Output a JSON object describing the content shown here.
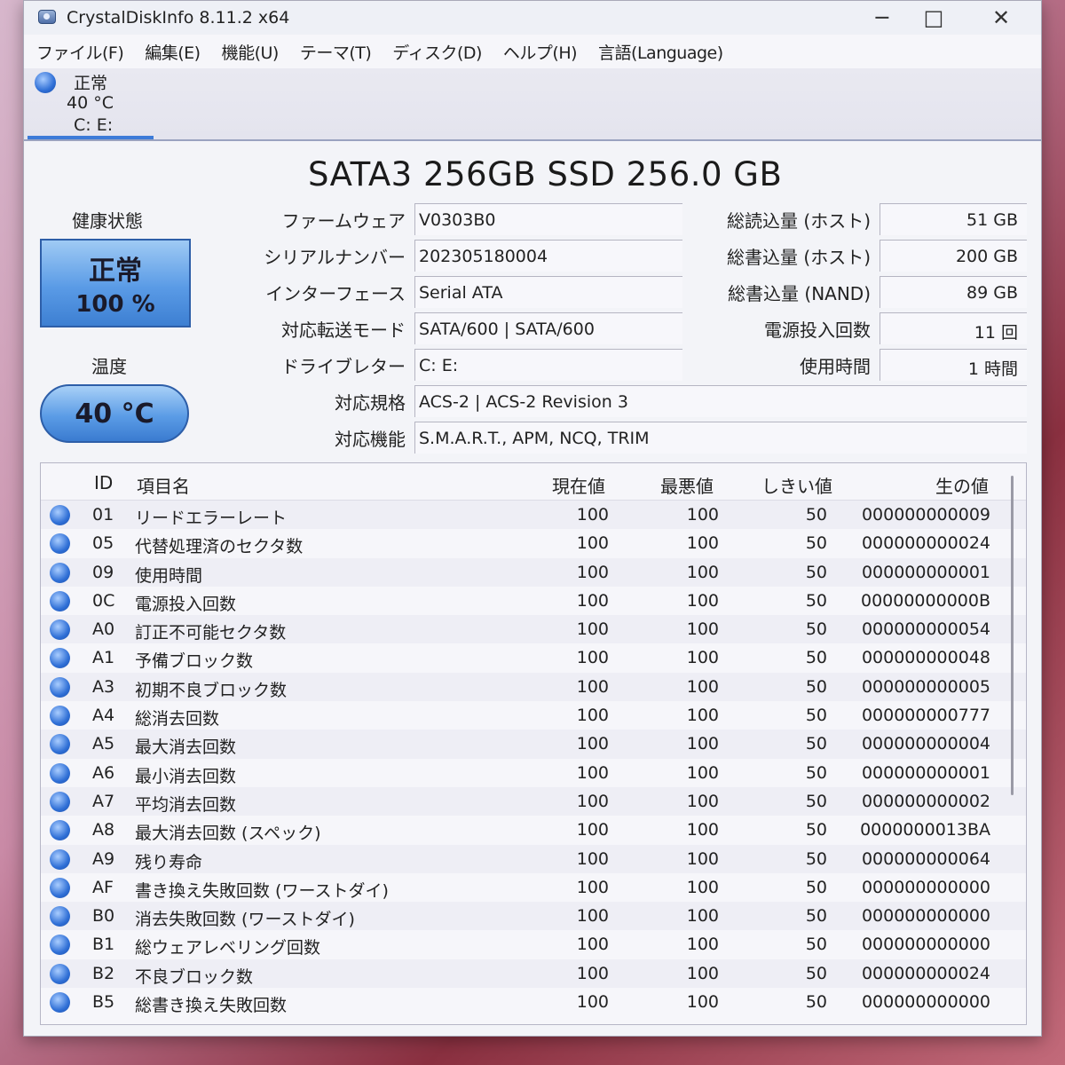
{
  "window": {
    "title": "CrystalDiskInfo 8.11.2 x64"
  },
  "menu": [
    "ファイル(F)",
    "編集(E)",
    "機能(U)",
    "テーマ(T)",
    "ディスク(D)",
    "ヘルプ(H)",
    "言語(Language)"
  ],
  "disk_tab": {
    "status": "正常",
    "temp": "40 °C",
    "drives": "C: E:"
  },
  "model": "SATA3 256GB SSD 256.0 GB",
  "health": {
    "label": "健康状態",
    "status": "正常",
    "percent": "100 %"
  },
  "temperature": {
    "label": "温度",
    "value": "40 °C"
  },
  "info": [
    {
      "label": "ファームウェア",
      "value": "V0303B0"
    },
    {
      "label": "シリアルナンバー",
      "value": "202305180004"
    },
    {
      "label": "インターフェース",
      "value": "Serial ATA"
    },
    {
      "label": "対応転送モード",
      "value": "SATA/600 | SATA/600"
    },
    {
      "label": "ドライブレター",
      "value": "C: E:"
    },
    {
      "label": "対応規格",
      "value": "ACS-2 | ACS-2 Revision 3"
    },
    {
      "label": "対応機能",
      "value": "S.M.A.R.T., APM, NCQ, TRIM"
    }
  ],
  "stats": [
    {
      "label": "総読込量 (ホスト)",
      "value": "51 GB"
    },
    {
      "label": "総書込量 (ホスト)",
      "value": "200 GB"
    },
    {
      "label": "総書込量 (NAND)",
      "value": "89 GB"
    },
    {
      "label": "電源投入回数",
      "value": "11 回"
    },
    {
      "label": "使用時間",
      "value": "1 時間"
    }
  ],
  "smart": {
    "headers": {
      "id": "ID",
      "name": "項目名",
      "current": "現在値",
      "worst": "最悪値",
      "threshold": "しきい値",
      "raw": "生の値"
    },
    "rows": [
      {
        "id": "01",
        "name": "リードエラーレート",
        "current": "100",
        "worst": "100",
        "threshold": "50",
        "raw": "000000000009"
      },
      {
        "id": "05",
        "name": "代替処理済のセクタ数",
        "current": "100",
        "worst": "100",
        "threshold": "50",
        "raw": "000000000024"
      },
      {
        "id": "09",
        "name": "使用時間",
        "current": "100",
        "worst": "100",
        "threshold": "50",
        "raw": "000000000001"
      },
      {
        "id": "0C",
        "name": "電源投入回数",
        "current": "100",
        "worst": "100",
        "threshold": "50",
        "raw": "00000000000B"
      },
      {
        "id": "A0",
        "name": "訂正不可能セクタ数",
        "current": "100",
        "worst": "100",
        "threshold": "50",
        "raw": "000000000054"
      },
      {
        "id": "A1",
        "name": "予備ブロック数",
        "current": "100",
        "worst": "100",
        "threshold": "50",
        "raw": "000000000048"
      },
      {
        "id": "A3",
        "name": "初期不良ブロック数",
        "current": "100",
        "worst": "100",
        "threshold": "50",
        "raw": "000000000005"
      },
      {
        "id": "A4",
        "name": "総消去回数",
        "current": "100",
        "worst": "100",
        "threshold": "50",
        "raw": "000000000777"
      },
      {
        "id": "A5",
        "name": "最大消去回数",
        "current": "100",
        "worst": "100",
        "threshold": "50",
        "raw": "000000000004"
      },
      {
        "id": "A6",
        "name": "最小消去回数",
        "current": "100",
        "worst": "100",
        "threshold": "50",
        "raw": "000000000001"
      },
      {
        "id": "A7",
        "name": "平均消去回数",
        "current": "100",
        "worst": "100",
        "threshold": "50",
        "raw": "000000000002"
      },
      {
        "id": "A8",
        "name": "最大消去回数 (スペック)",
        "current": "100",
        "worst": "100",
        "threshold": "50",
        "raw": "0000000013BA"
      },
      {
        "id": "A9",
        "name": "残り寿命",
        "current": "100",
        "worst": "100",
        "threshold": "50",
        "raw": "000000000064"
      },
      {
        "id": "AF",
        "name": "書き換え失敗回数 (ワーストダイ)",
        "current": "100",
        "worst": "100",
        "threshold": "50",
        "raw": "000000000000"
      },
      {
        "id": "B0",
        "name": "消去失敗回数 (ワーストダイ)",
        "current": "100",
        "worst": "100",
        "threshold": "50",
        "raw": "000000000000"
      },
      {
        "id": "B1",
        "name": "総ウェアレベリング回数",
        "current": "100",
        "worst": "100",
        "threshold": "50",
        "raw": "000000000000"
      },
      {
        "id": "B2",
        "name": "不良ブロック数",
        "current": "100",
        "worst": "100",
        "threshold": "50",
        "raw": "000000000024"
      },
      {
        "id": "B5",
        "name": "総書き換え失敗回数",
        "current": "100",
        "worst": "100",
        "threshold": "50",
        "raw": "000000000000"
      }
    ]
  }
}
